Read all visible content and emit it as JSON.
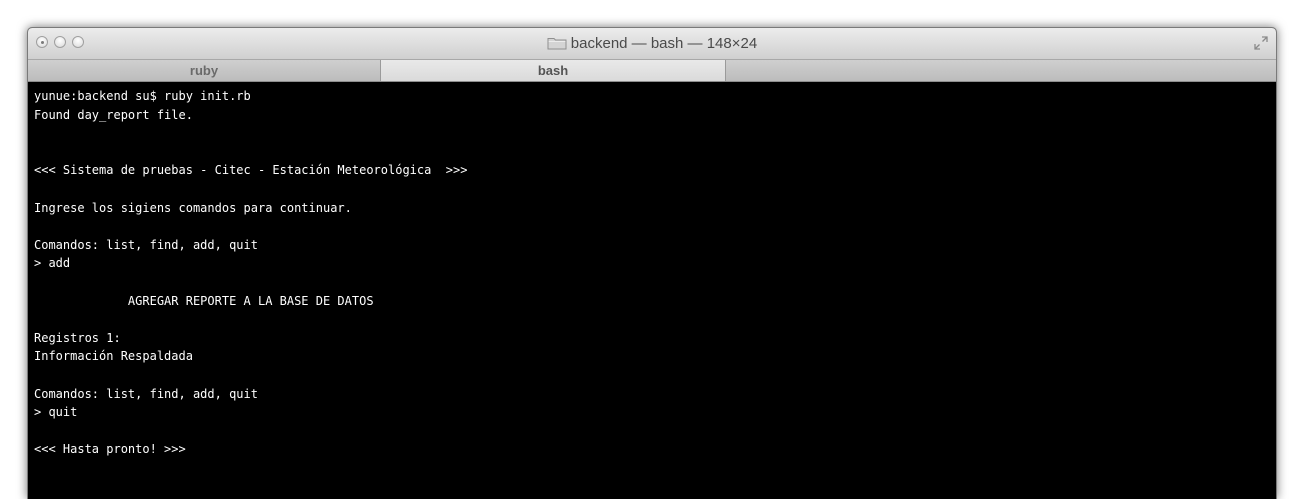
{
  "window": {
    "title": "backend — bash — 148×24"
  },
  "tabs": [
    {
      "label": "ruby",
      "active": false
    },
    {
      "label": "bash",
      "active": true
    }
  ],
  "terminal": {
    "lines": [
      "yunue:backend su$ ruby init.rb",
      "Found day_report file.",
      "",
      "",
      "<<< Sistema de pruebas - Citec - Estación Meteorológica  >>>",
      "",
      "Ingrese los sigiens comandos para continuar.",
      "",
      "Comandos: list, find, add, quit",
      "> add",
      "",
      "             AGREGAR REPORTE A LA BASE DE DATOS",
      "",
      "Registros 1:",
      "Información Respaldada",
      "",
      "Comandos: list, find, add, quit",
      "> quit",
      "",
      "<<< Hasta pronto! >>>"
    ]
  },
  "colors": {
    "terminal_bg": "#000000",
    "terminal_fg": "#ffffff",
    "titlebar": "#dcdcdc"
  },
  "icons": {
    "title_icon": "folder-icon",
    "corner_icon": "fullscreen-icon"
  }
}
